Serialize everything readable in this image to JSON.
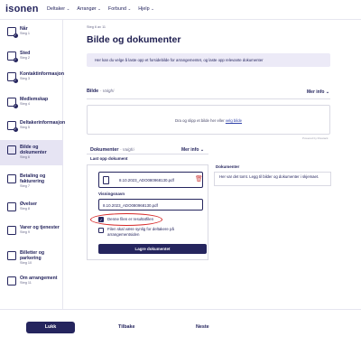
{
  "brand": {
    "logo_text": "isonen"
  },
  "nav": {
    "items": [
      {
        "label": "Deltaker"
      },
      {
        "label": "Arrangør"
      },
      {
        "label": "Forbund"
      },
      {
        "label": "Hjelp"
      }
    ]
  },
  "sidebar": {
    "steps": [
      {
        "title": "Når",
        "sub": "Steg 1"
      },
      {
        "title": "Sted",
        "sub": "Steg 2"
      },
      {
        "title": "Kontaktinformasjon",
        "sub": "Steg 3"
      },
      {
        "title": "Medlemskap",
        "sub": "Steg 4"
      },
      {
        "title": "Deltakerinformasjon",
        "sub": "Steg 5"
      },
      {
        "title": "Bilde og dokumenter",
        "sub": "Steg 6"
      },
      {
        "title": "Betaling og fakturering",
        "sub": "Steg 7"
      },
      {
        "title": "Øvelser",
        "sub": "Steg 8"
      },
      {
        "title": "Varer og tjenester",
        "sub": "Steg 9"
      },
      {
        "title": "Billetter og parkering",
        "sub": "Steg 10"
      },
      {
        "title": "Om arrangement",
        "sub": "Steg 11"
      }
    ]
  },
  "main": {
    "step_counter": "Steg 6 av 11",
    "title": "Bilde og dokumenter",
    "info": "Her kan du velge å laste opp et forsidebilde for arrangementet, og laste opp relevante dokumenter",
    "bilde": {
      "label": "Bilde",
      "optional": "- Valgfri",
      "mer_info": "Mer info",
      "dropzone_text": "Dra og slipp et bilde her eller ",
      "dropzone_link": "velg bilde",
      "powered": "Powered by Filestack"
    },
    "dokumenter": {
      "label": "Dokumenter",
      "optional": "- Valgfri",
      "mer_info": "Mer info",
      "last_opp": "Last opp dokument",
      "filename": "8.10.2023_ADO080968130.pdf",
      "visningsnavn_label": "Visningsnavn",
      "visningsnavn_value": "8.10.2023_ADO080968130.pdf",
      "checkbox1": "Denne filen er resultatfilen",
      "checkbox2": "Filen skal være synlig for deltakere på arrangementsiden",
      "save_button": "Lagre dokumentet",
      "aside_title": "Dokumenter",
      "aside_text": "Her var det tomt. Legg til bilder og dokumenter i skjemaet."
    }
  },
  "footer": {
    "lukk": "Lukk",
    "tilbake": "Tilbake",
    "neste": "Neste"
  },
  "colors": {
    "primary": "#25255e",
    "info_bg": "#eceaf7",
    "highlight_circle": "#d62828",
    "active_step_bg": "#e6e4f3"
  }
}
